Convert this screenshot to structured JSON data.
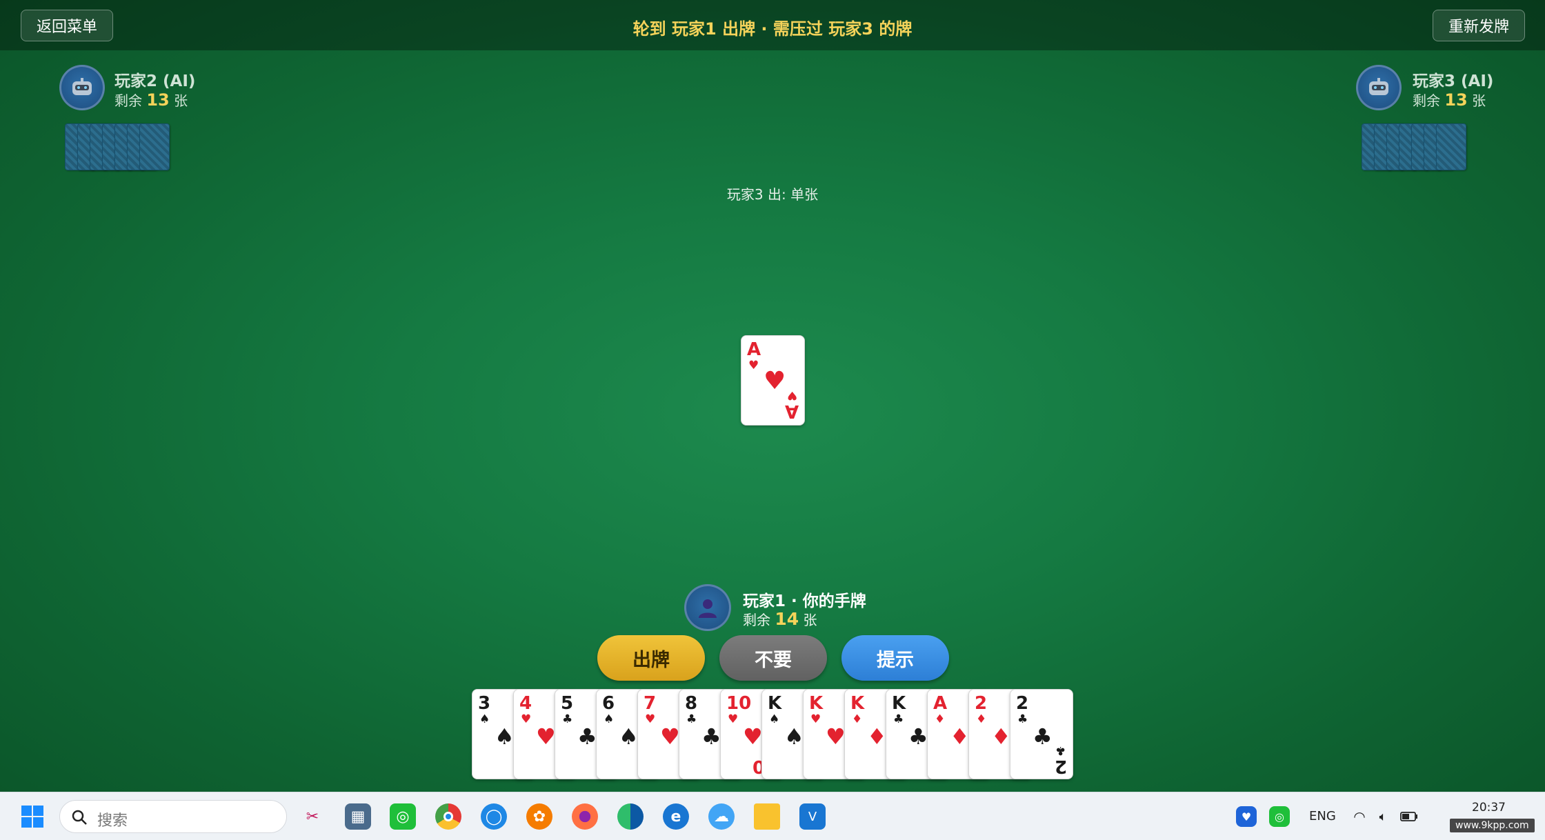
{
  "topbar": {
    "back_label": "返回菜单",
    "redeal_label": "重新发牌",
    "turn_status": "轮到 玩家1 出牌 · 需压过 玩家3 的牌"
  },
  "opponents": [
    {
      "name": "玩家2 (AI)",
      "count_prefix": "剩余",
      "count": "13",
      "count_suffix": "张"
    },
    {
      "name": "玩家3 (AI)",
      "count_prefix": "剩余",
      "count": "13",
      "count_suffix": "张"
    }
  ],
  "table": {
    "play_info": "玩家3 出: 单张",
    "center_card": {
      "rank": "A",
      "suit": "♥",
      "color": "red"
    }
  },
  "player": {
    "name": "玩家1 · 你的手牌",
    "count_prefix": "剩余",
    "count": "14",
    "count_suffix": "张"
  },
  "actions": {
    "play": "出牌",
    "pass": "不要",
    "hint": "提示"
  },
  "hand": [
    {
      "rank": "3",
      "suit": "♠",
      "color": "black"
    },
    {
      "rank": "4",
      "suit": "♥",
      "color": "red"
    },
    {
      "rank": "5",
      "suit": "♣",
      "color": "black"
    },
    {
      "rank": "6",
      "suit": "♠",
      "color": "black"
    },
    {
      "rank": "7",
      "suit": "♥",
      "color": "red"
    },
    {
      "rank": "8",
      "suit": "♣",
      "color": "black"
    },
    {
      "rank": "10",
      "suit": "♥",
      "color": "red"
    },
    {
      "rank": "K",
      "suit": "♠",
      "color": "black"
    },
    {
      "rank": "K",
      "suit": "♥",
      "color": "red"
    },
    {
      "rank": "K",
      "suit": "♦",
      "color": "red"
    },
    {
      "rank": "K",
      "suit": "♣",
      "color": "black"
    },
    {
      "rank": "A",
      "suit": "♦",
      "color": "red"
    },
    {
      "rank": "2",
      "suit": "♦",
      "color": "red"
    },
    {
      "rank": "2",
      "suit": "♣",
      "color": "black"
    }
  ],
  "taskbar": {
    "search_placeholder": "搜索",
    "lang": "ENG",
    "time": "20:37",
    "watermark": "www.9kpp.com",
    "apps": [
      "start-icon",
      "search-icon",
      "snipping-tool-icon",
      "calculator-icon",
      "wechat-icon",
      "chrome-icon",
      "app-blue-icon",
      "app-orange-icon",
      "firefox-icon",
      "edge-icon",
      "ie-icon",
      "app-cloud-icon",
      "folder-icon",
      "vscode-icon"
    ]
  }
}
